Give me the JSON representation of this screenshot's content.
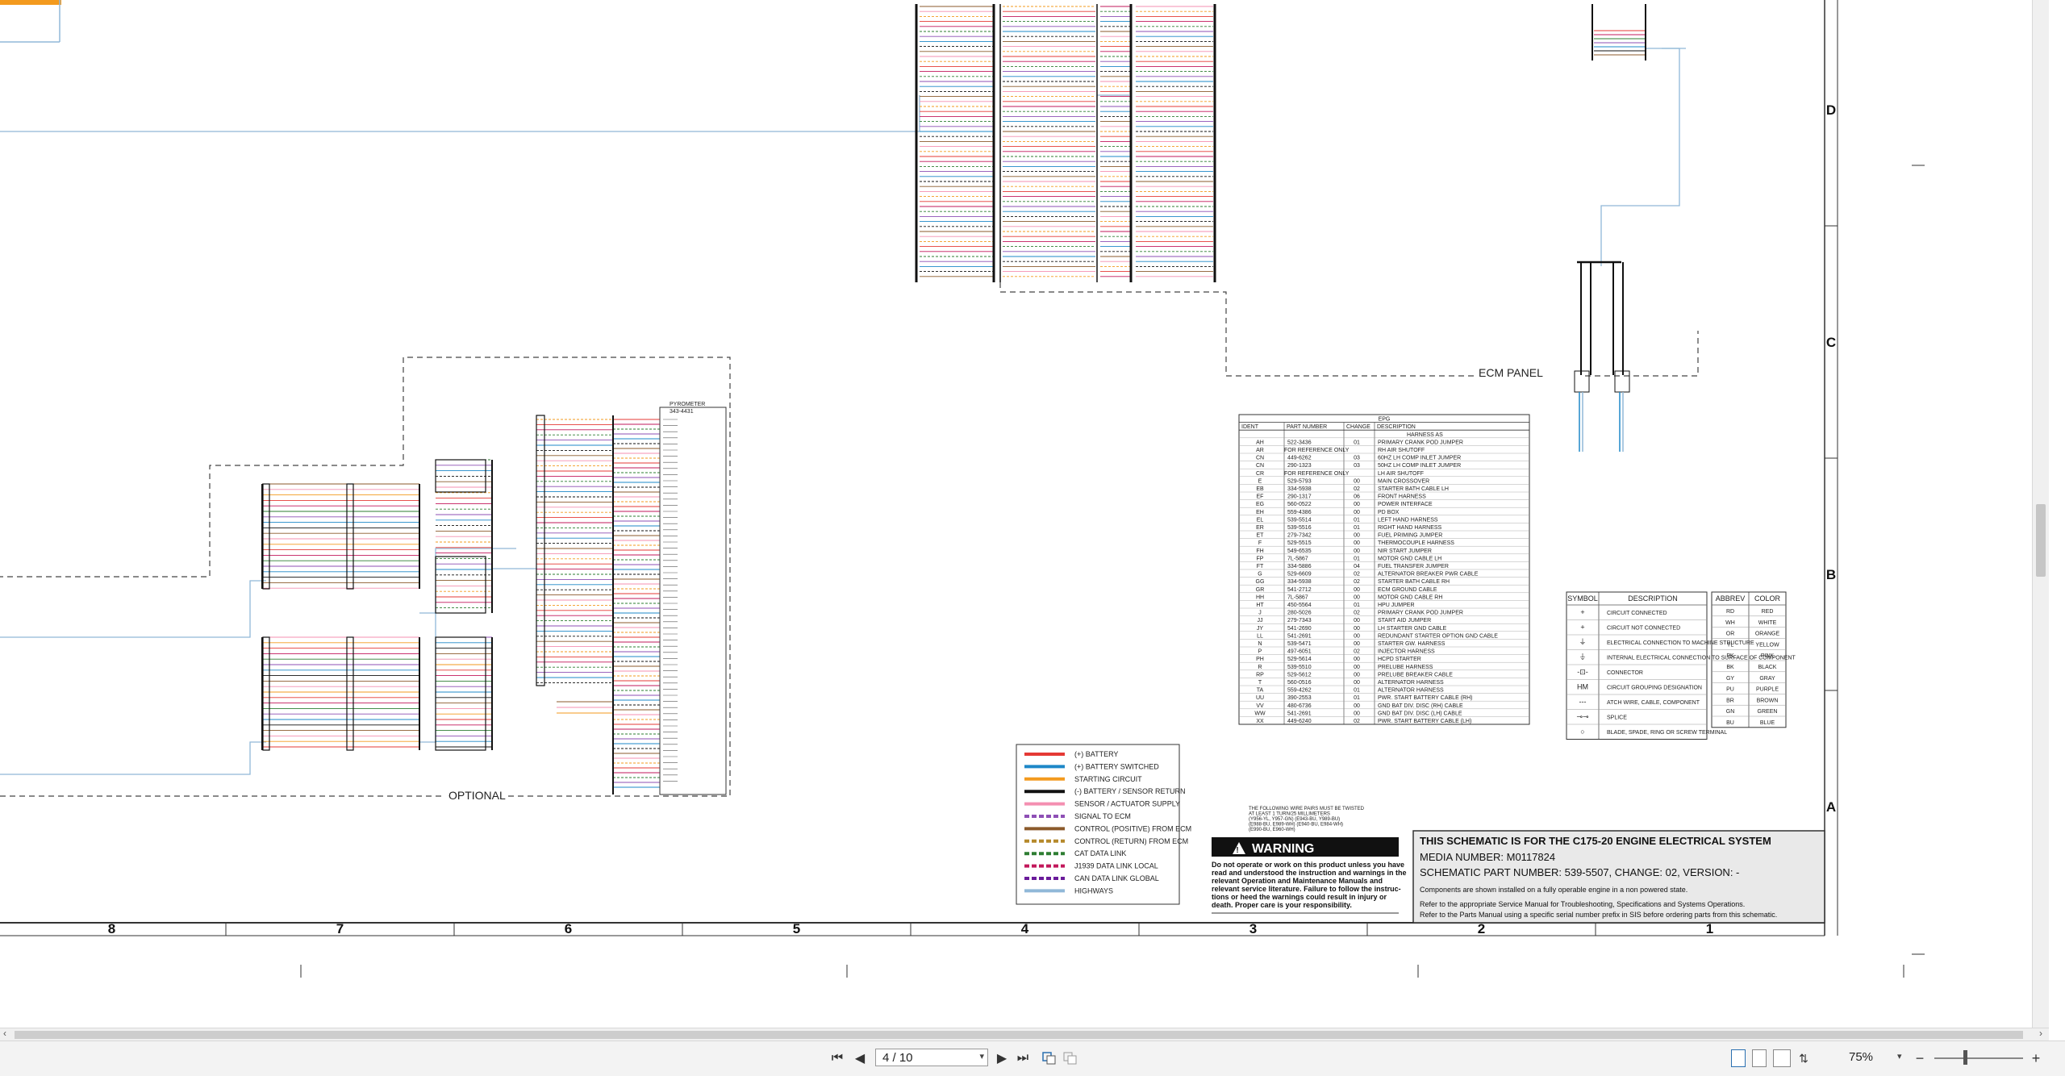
{
  "toolbar": {
    "first_page": "⏮",
    "prev_page": "◀",
    "page_display": "4 / 10",
    "next_page": "▶",
    "last_page": "⏭",
    "zoom": "75%",
    "zoom_out": "−",
    "zoom_in": "+"
  },
  "schematic": {
    "zone_numbers": [
      "8",
      "7",
      "6",
      "5",
      "4",
      "3",
      "2",
      "1"
    ],
    "zone_letters": [
      "D",
      "C",
      "B",
      "A"
    ],
    "ecm_panel_label": "ECM PANEL",
    "optional_label": "OPTIONAL",
    "warning_title": "WARNING",
    "warning_text": [
      "Do not operate or work on this product unless you have",
      "read and understood the instruction and warnings in the",
      "relevant Operation and Maintenance Manuals and",
      "relevant service literature. Failure to follow the instruc-",
      "tions or heed the warnings could result in injury or",
      "death. Proper care is your responsibility."
    ],
    "twisted_note": [
      "THE FOLLOWING WIRE PAIRS MUST BE TWISTED",
      "AT LEAST 1 TURN/25 MILLIMETERS",
      "(Y956-YL, Y957-GN) (E943-BU, Y989-BU)",
      "(E988-BU, E989-WH) (E940-BU, E984-WH)",
      "(E990-BU, E960-WH)"
    ],
    "title_block": {
      "line1": "THIS SCHEMATIC IS FOR THE C175-20 ENGINE ELECTRICAL SYSTEM",
      "line2": "MEDIA NUMBER: M0117824",
      "line3": "SCHEMATIC PART NUMBER: 539-5507, CHANGE: 02, VERSION: -",
      "line4": "Components are shown installed on a fully operable engine in a non powered state.",
      "line5": "Refer to the appropriate Service Manual for Troubleshooting, Specifications and Systems Operations.",
      "line6": "Refer to the Parts Manual using a specific serial number prefix in SIS before ordering parts from this schematic."
    },
    "legend": [
      {
        "label": "(+) BATTERY",
        "color": "#e53935",
        "style": "solid"
      },
      {
        "label": "(+) BATTERY SWITCHED",
        "color": "#1e88c8",
        "style": "solid"
      },
      {
        "label": "STARTING CIRCUIT",
        "color": "#f39a1e",
        "style": "solid"
      },
      {
        "label": "(-) BATTERY / SENSOR RETURN",
        "color": "#111111",
        "style": "solid"
      },
      {
        "label": "SENSOR / ACTUATOR SUPPLY",
        "color": "#f48fb1",
        "style": "solid"
      },
      {
        "label": "SIGNAL TO ECM",
        "color": "#8e4fb5",
        "style": "dash"
      },
      {
        "label": "CONTROL (POSITIVE) FROM ECM",
        "color": "#8b5a2b",
        "style": "solid"
      },
      {
        "label": "CONTROL (RETURN) FROM ECM",
        "color": "#b5892b",
        "style": "dash"
      },
      {
        "label": "CAT DATA LINK",
        "color": "#2e7d32",
        "style": "dash"
      },
      {
        "label": "J1939 DATA LINK LOCAL",
        "color": "#c2185b",
        "style": "dash"
      },
      {
        "label": "CAN DATA LINK GLOBAL",
        "color": "#6a1b9a",
        "style": "dash"
      },
      {
        "label": "HIGHWAYS",
        "color": "#90b8d8",
        "style": "solid"
      }
    ],
    "epg_table": {
      "title": "EPG",
      "headers": [
        "IDENT",
        "PART NUMBER",
        "CHANGE",
        "DESCRIPTION"
      ],
      "subheader": "HARNESS AS",
      "rows": [
        [
          "AH",
          "522-3436",
          "01",
          "PRIMARY CRANK POD JUMPER"
        ],
        [
          "AR",
          "FOR REFERENCE ONLY",
          "",
          "RH AIR SHUTOFF"
        ],
        [
          "CN",
          "449-6262",
          "03",
          "60HZ LH COMP INLET JUMPER"
        ],
        [
          "CN",
          "290-1323",
          "03",
          "50HZ LH COMP INLET JUMPER"
        ],
        [
          "CR",
          "FOR REFERENCE ONLY",
          "",
          "LH AIR SHUTOFF"
        ],
        [
          "E",
          "529-5793",
          "00",
          "MAIN CROSSOVER"
        ],
        [
          "EB",
          "334-5938",
          "02",
          "STARTER BATH CABLE LH"
        ],
        [
          "EF",
          "290-1317",
          "06",
          "FRONT HARNESS"
        ],
        [
          "EG",
          "560-0522",
          "00",
          "POWER INTERFACE"
        ],
        [
          "EH",
          "559-4386",
          "00",
          "PD BOX"
        ],
        [
          "EL",
          "539-5514",
          "01",
          "LEFT HAND HARNESS"
        ],
        [
          "ER",
          "539-5516",
          "01",
          "RIGHT HAND HARNESS"
        ],
        [
          "ET",
          "279-7342",
          "00",
          "FUEL PRIMING JUMPER"
        ],
        [
          "F",
          "529-5515",
          "00",
          "THERMOCOUPLE HARNESS"
        ],
        [
          "FH",
          "549-6535",
          "00",
          "NIR START JUMPER"
        ],
        [
          "FP",
          "7L-5867",
          "01",
          "MOTOR GND CABLE LH"
        ],
        [
          "FT",
          "334-5886",
          "04",
          "FUEL TRANSFER JUMPER"
        ],
        [
          "G",
          "529-6609",
          "02",
          "ALTERNATOR BREAKER PWR CABLE"
        ],
        [
          "GG",
          "334-5938",
          "02",
          "STARTER BATH CABLE RH"
        ],
        [
          "GR",
          "541-2712",
          "00",
          "ECM GROUND CABLE"
        ],
        [
          "HH",
          "7L-5867",
          "00",
          "MOTOR GND CABLE RH"
        ],
        [
          "HT",
          "450-5564",
          "01",
          "HPU JUMPER"
        ],
        [
          "J",
          "280-5026",
          "02",
          "PRIMARY CRANK POD JUMPER"
        ],
        [
          "JJ",
          "279-7343",
          "00",
          "START AID JUMPER"
        ],
        [
          "JY",
          "541-2690",
          "00",
          "LH STARTER GND CABLE"
        ],
        [
          "LL",
          "541-2691",
          "00",
          "REDUNDANT STARTER OPTION GND CABLE"
        ],
        [
          "N",
          "539-5471",
          "00",
          "STARTER GW. HARNESS"
        ],
        [
          "P",
          "497-6051",
          "02",
          "INJECTOR HARNESS"
        ],
        [
          "PH",
          "529-5614",
          "00",
          "HCPD STARTER"
        ],
        [
          "R",
          "539-5510",
          "00",
          "PRELUBE HARNESS"
        ],
        [
          "RP",
          "529-5612",
          "00",
          "PRELUBE BREAKER CABLE"
        ],
        [
          "T",
          "560-0516",
          "00",
          "ALTERNATOR HARNESS"
        ],
        [
          "TA",
          "559-4262",
          "01",
          "ALTERNATOR HARNESS"
        ],
        [
          "UU",
          "390-2553",
          "01",
          "PWR. START BATTERY CABLE (RH)"
        ],
        [
          "VV",
          "480-6736",
          "00",
          "GND BAT DIV. DISC (RH) CABLE"
        ],
        [
          "WW",
          "541-2691",
          "00",
          "GND BAT DIV. DISC (LH) CABLE"
        ],
        [
          "XX",
          "449-6240",
          "02",
          "PWR. START BATTERY CABLE (LH)"
        ]
      ]
    },
    "symbol_table": {
      "headers": [
        "SYMBOL",
        "DESCRIPTION"
      ],
      "rows": [
        [
          "+",
          "CIRCUIT CONNECTED"
        ],
        [
          "+",
          "CIRCUIT NOT CONNECTED"
        ],
        [
          "⏚",
          "ELECTRICAL CONNECTION TO MACHINE STRUCTURE"
        ],
        [
          "⏚",
          "INTERNAL ELECTRICAL CONNECTION TO SURFACE OF COMPONENT"
        ],
        [
          "-⊡-",
          "CONNECTOR"
        ],
        [
          "HM",
          "CIRCUIT GROUPING DESIGNATION"
        ],
        [
          "---",
          "ATCH WIRE, CABLE, COMPONENT"
        ],
        [
          "⊸⊸",
          "SPLICE"
        ],
        [
          "○",
          "BLADE, SPADE, RING OR SCREW TERMINAL"
        ]
      ]
    },
    "color_table": {
      "headers": [
        "ABBREV",
        "COLOR"
      ],
      "rows": [
        [
          "RD",
          "RED"
        ],
        [
          "WH",
          "WHITE"
        ],
        [
          "OR",
          "ORANGE"
        ],
        [
          "YL",
          "YELLOW"
        ],
        [
          "PK",
          "PINK"
        ],
        [
          "BK",
          "BLACK"
        ],
        [
          "GY",
          "GRAY"
        ],
        [
          "PU",
          "PURPLE"
        ],
        [
          "BR",
          "BROWN"
        ],
        [
          "GN",
          "GREEN"
        ],
        [
          "BU",
          "BLUE"
        ]
      ]
    },
    "pyrometer_label": "PYROMETER",
    "pyrometer_part": "343-4431"
  }
}
